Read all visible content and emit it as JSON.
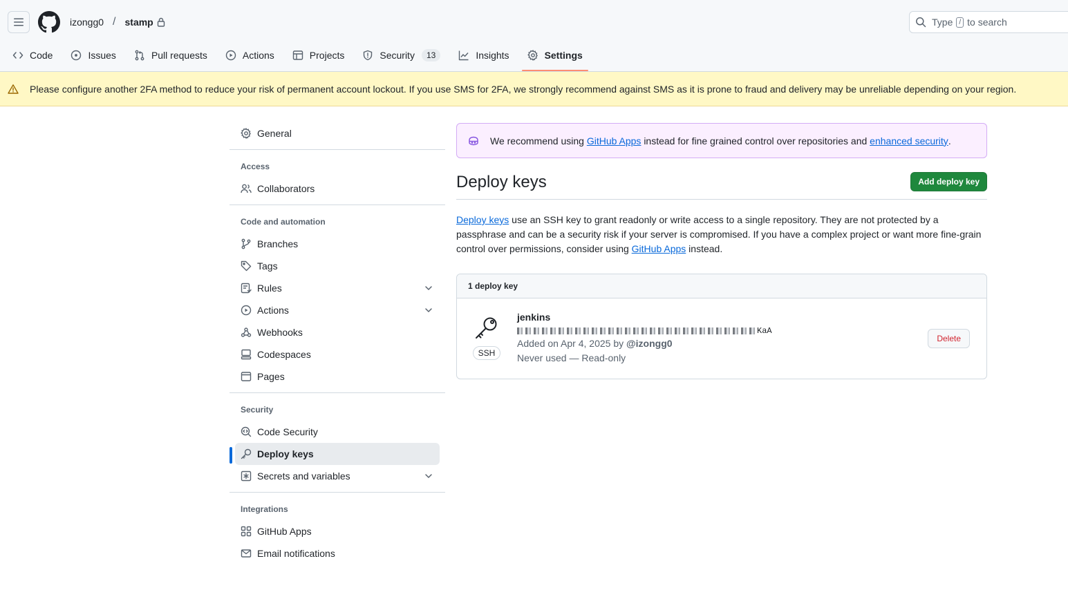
{
  "header": {
    "owner": "izongg0",
    "separator": "/",
    "repo": "stamp",
    "search": {
      "prefix": "Type",
      "key": "/",
      "suffix": "to search"
    }
  },
  "tabs": [
    {
      "label": "Code",
      "icon": "code-icon"
    },
    {
      "label": "Issues",
      "icon": "issue-icon"
    },
    {
      "label": "Pull requests",
      "icon": "pull-request-icon"
    },
    {
      "label": "Actions",
      "icon": "play-icon"
    },
    {
      "label": "Projects",
      "icon": "table-icon"
    },
    {
      "label": "Security",
      "icon": "shield-icon",
      "counter": "13"
    },
    {
      "label": "Insights",
      "icon": "graph-icon"
    },
    {
      "label": "Settings",
      "icon": "gear-icon",
      "active": true
    }
  ],
  "banner": {
    "text": "Please configure another 2FA method to reduce your risk of permanent account lockout. If you use SMS for 2FA, we strongly recommend against SMS as it is prone to fraud and delivery may be unreliable depending on your region."
  },
  "sidebar": {
    "general": "General",
    "access_heading": "Access",
    "collaborators": "Collaborators",
    "code_heading": "Code and automation",
    "branches": "Branches",
    "tags": "Tags",
    "rules": "Rules",
    "actions": "Actions",
    "webhooks": "Webhooks",
    "codespaces": "Codespaces",
    "pages": "Pages",
    "security_heading": "Security",
    "code_security": "Code Security",
    "deploy_keys": "Deploy keys",
    "secrets": "Secrets and variables",
    "integrations_heading": "Integrations",
    "github_apps": "GitHub Apps",
    "email_notifications": "Email notifications"
  },
  "flash": {
    "prefix": "We recommend using",
    "link1": "GitHub Apps",
    "middle": "instead for fine grained control over repositories and",
    "link2": "enhanced security",
    "suffix": "."
  },
  "page": {
    "title": "Deploy keys",
    "add_button": "Add deploy key",
    "desc_link": "Deploy keys",
    "desc_text": "use an SSH key to grant readonly or write access to a single repository. They are not protected by a passphrase and can be a security risk if your server is compromised. If you have a complex project or want more fine-grain control over permissions, consider using",
    "desc_link2": "GitHub Apps",
    "desc_end": "instead."
  },
  "keys": {
    "count_label": "1 deploy key",
    "items": [
      {
        "title": "jenkins",
        "type": "SSH",
        "fingerprint_end": "KaA",
        "added": "Added on Apr 4, 2025 by",
        "added_by": "@izongg0",
        "usage": "Never used — Read-only",
        "delete_label": "Delete"
      }
    ]
  },
  "colors": {
    "accent": "#0969da",
    "primary_button": "#1f883d",
    "danger": "#d1242f",
    "tab_underline": "#fd8c73",
    "banner_bg": "#fff8c5",
    "flash_bg": "#fbefff"
  }
}
